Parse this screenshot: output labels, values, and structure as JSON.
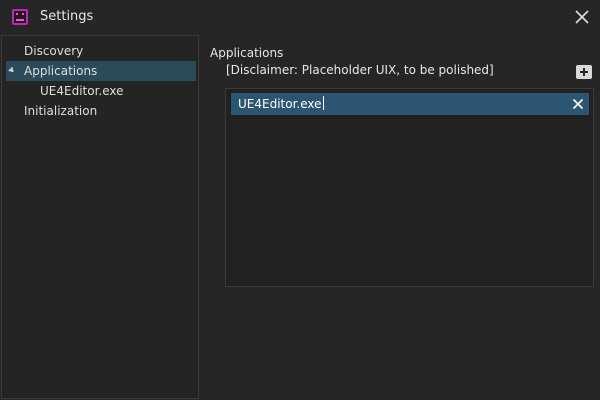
{
  "window": {
    "title": "Settings",
    "app_icon": "app-logo-icon",
    "close_icon": "close-icon"
  },
  "sidebar": {
    "items": [
      {
        "label": "Discovery",
        "selected": false,
        "expanded": null
      },
      {
        "label": "Applications",
        "selected": true,
        "expanded": true
      },
      {
        "label": "UE4Editor.exe",
        "selected": false,
        "expanded": null
      },
      {
        "label": "Initialization",
        "selected": false,
        "expanded": null
      }
    ]
  },
  "main": {
    "section_title": "Applications",
    "disclaimer": "[Disclaimer: Placeholder UIX, to be polished]",
    "add_icon": "plus-icon",
    "applications": [
      {
        "value": "UE4Editor.exe",
        "remove_icon": "close-icon"
      }
    ]
  },
  "colors": {
    "background": "#262626",
    "selection": "#2b4b5a",
    "list_row": "#2b5570",
    "accent": "#c026b7"
  }
}
